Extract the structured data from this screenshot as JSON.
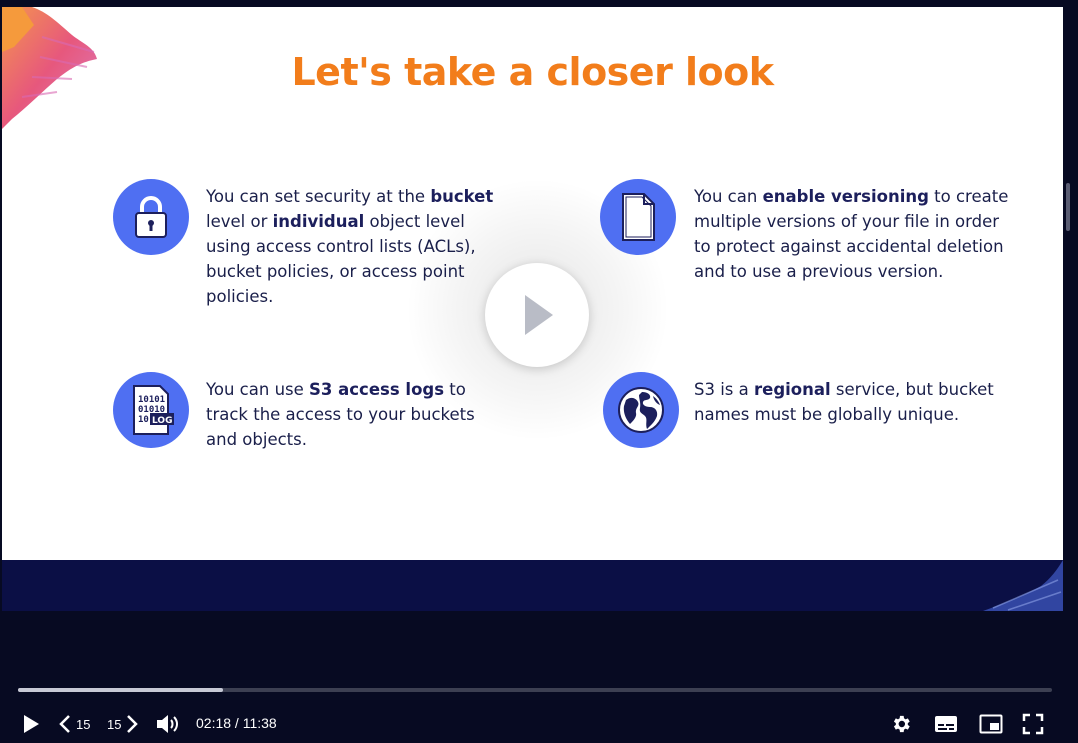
{
  "slide": {
    "title": "Let's take a closer look",
    "features": [
      {
        "icon": "lock-icon",
        "segments": [
          {
            "t": "You can set security at the ",
            "b": false
          },
          {
            "t": "bucket",
            "b": true
          },
          {
            "t": " level or ",
            "b": false
          },
          {
            "t": "individual",
            "b": true
          },
          {
            "t": " object level using access control lists (ACLs), bucket policies, or access point policies.",
            "b": false
          }
        ]
      },
      {
        "icon": "document-icon",
        "segments": [
          {
            "t": "You can ",
            "b": false
          },
          {
            "t": "enable versioning",
            "b": true
          },
          {
            "t": " to create multiple versions of your file in order to protect against accidental deletion and to use a previous version.",
            "b": false
          }
        ]
      },
      {
        "icon": "log-file-icon",
        "segments": [
          {
            "t": "You can use ",
            "b": false
          },
          {
            "t": "S3 access logs",
            "b": true
          },
          {
            "t": " to track the access to your buckets and objects.",
            "b": false
          }
        ]
      },
      {
        "icon": "globe-icon",
        "segments": [
          {
            "t": "S3 is a ",
            "b": false
          },
          {
            "t": "regional",
            "b": true
          },
          {
            "t": " service, but bucket names must be globally unique.",
            "b": false
          }
        ]
      }
    ],
    "log_icon_text": {
      "bits": [
        "10101",
        "01010",
        "10"
      ],
      "label": "LOG"
    }
  },
  "player": {
    "progress": 0.198,
    "skip_back_label": "15",
    "skip_forward_label": "15",
    "time": "02:18 / 11:38"
  },
  "colors": {
    "title": "#f27d1b",
    "icon_circle": "#4f6ff2",
    "text": "#1a1f4a",
    "player_bg": "#070a22"
  }
}
